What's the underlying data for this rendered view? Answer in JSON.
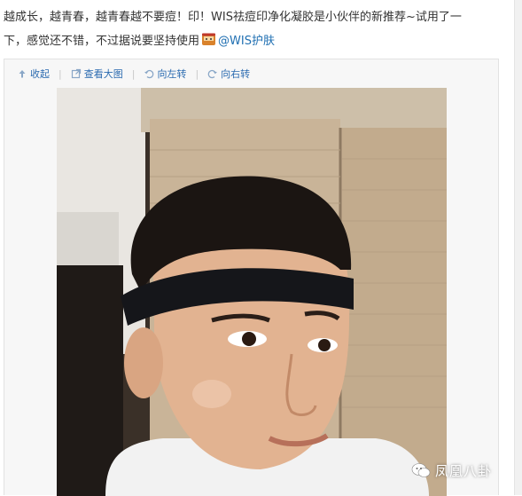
{
  "post": {
    "line1": "越成长，越青春，越青春越不要痘！印！WIS祛痘印净化凝胶是小伙伴的新推荐~试用了一",
    "line2_prefix": "下，感觉还不错，不过据说要坚持使用",
    "mention": "@WIS护肤"
  },
  "toolbar": {
    "collapse": "收起",
    "view_large": "查看大图",
    "rotate_left": "向左转",
    "rotate_right": "向右转"
  },
  "watermark": "凤凰八卦",
  "colors": {
    "link": "#2b6bb0",
    "mention": "#1f6fb2",
    "text": "#333333"
  },
  "icons": [
    "collapse-arrow-icon",
    "view-large-icon",
    "rotate-left-icon",
    "rotate-right-icon",
    "emoji-icon",
    "wechat-icon"
  ]
}
